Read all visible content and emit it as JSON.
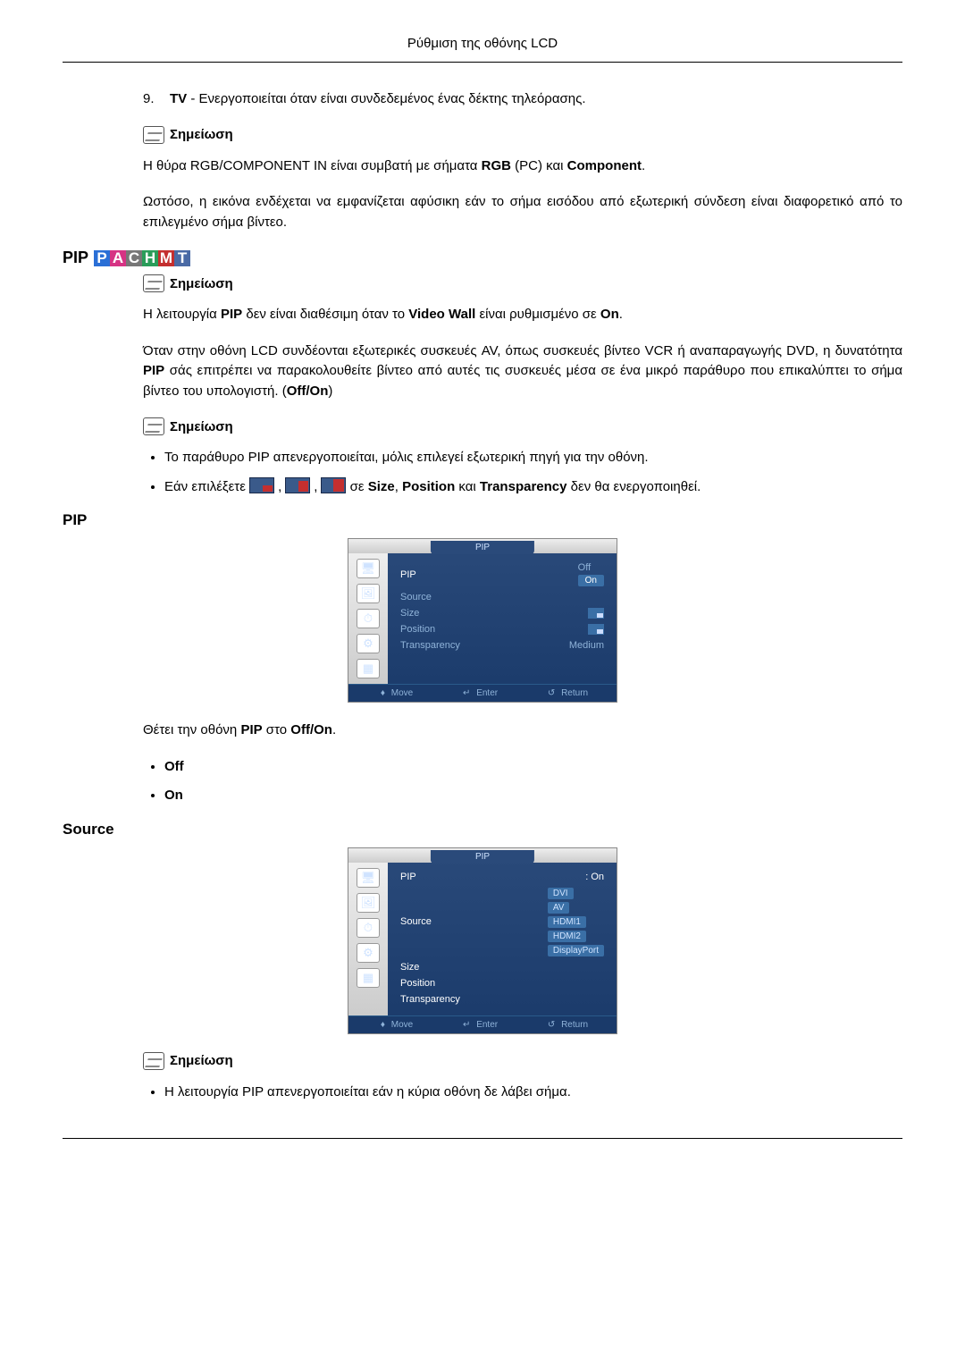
{
  "header": "Ρύθμιση της οθόνης LCD",
  "item9": {
    "num": "9.",
    "text_prefix": " - Ενεργοποιείται όταν είναι συνδεδεμένος ένας δέκτης τηλεόρασης.",
    "tv": "TV"
  },
  "note_label": "Σημείωση",
  "para1_a": "Η θύρα RGB/COMPONENT IN είναι συμβατή με σήματα ",
  "para1_b": " (PC) και ",
  "rgb": "RGB",
  "component": "Component",
  "para1_end": ".",
  "para2": "Ωστόσο, η εικόνα ενδέχεται να εμφανίζεται αφύσικη εάν το σήμα εισόδου από εξωτερική σύνδεση είναι διαφορετικό από το επιλεγμένο σήμα βίντεο.",
  "pip_heading": "PIP",
  "pip_avail_a": "Η λειτουργία ",
  "pip_avail_b": " δεν είναι διαθέσιμη όταν το ",
  "pip_avail_c": " είναι ρυθμισμένο σε ",
  "pip_word": "PIP",
  "videowall": "Video Wall",
  "on": "On",
  "off": "Off",
  "pip_desc_a": "Όταν στην οθόνη LCD συνδέονται εξωτερικές συσκευές AV, όπως συσκευές βίντεο VCR ή αναπαραγωγής DVD, η δυνατότητα ",
  "pip_desc_b": " σάς επιτρέπει να παρακολουθείτε βίντεο από αυτές τις συσκευές μέσα σε ένα μικρό παράθυρο που επικαλύπτει το σήμα βίντεο του υπολογιστή. (",
  "offon": "Off/On",
  "close_paren": ")",
  "bullet1": "Το παράθυρο PIP απενεργοποιείται, μόλις επιλεγεί εξωτερική πηγή για την οθόνη.",
  "bullet2_a": "Εάν επιλέξετε ",
  "bullet2_b": " σε ",
  "bullet2_c": " και ",
  "bullet2_d": " δεν θα ενεργοποιηθεί.",
  "size": "Size",
  "position": "Position",
  "transparency": "Transparency",
  "sub_pip": "PIP",
  "sub_source": "Source",
  "set_text_a": "Θέτει την οθόνη ",
  "set_text_b": " στο ",
  "set_text_c": ".",
  "opt_off": "Off",
  "opt_on": "On",
  "bullet3": "Η λειτουργία PIP απενεργοποιείται εάν η κύρια οθόνη δε λάβει σήμα.",
  "osd1": {
    "title": "PIP",
    "rows": {
      "pip": "PIP",
      "source": "Source",
      "size": "Size",
      "position": "Position",
      "transparency": "Transparency",
      "off": "Off",
      "on": "On",
      "medium": "Medium"
    },
    "footer": {
      "move": "Move",
      "enter": "Enter",
      "return": "Return"
    }
  },
  "osd2": {
    "title": "PIP",
    "rows": {
      "pip": "PIP",
      "pip_val": ": On",
      "source": "Source",
      "size": "Size",
      "position": "Position",
      "transparency": "Transparency"
    },
    "sources": [
      "DVI",
      "AV",
      "HDMI1",
      "HDMI2",
      "DisplayPort"
    ],
    "footer": {
      "move": "Move",
      "enter": "Enter",
      "return": "Return"
    }
  }
}
